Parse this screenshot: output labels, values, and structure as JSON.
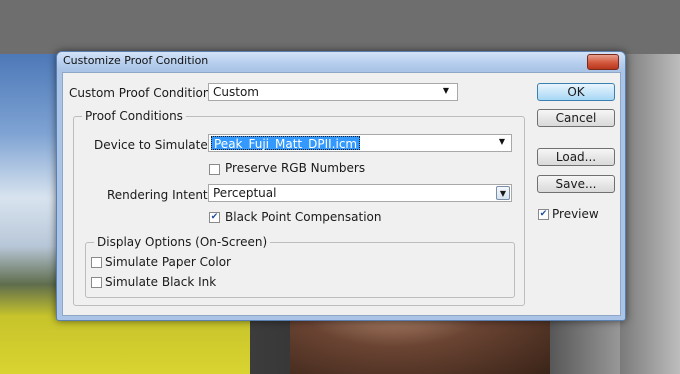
{
  "dialog": {
    "title": "Customize Proof Condition",
    "close_glyph": "✕"
  },
  "custom_condition": {
    "label": "Custom Proof Condition:",
    "value": "Custom"
  },
  "proof_conditions": {
    "group_title": "Proof Conditions",
    "device_label": "Device to Simulate:",
    "device_value": "Peak_Fuji_Matt_DPII.icm",
    "preserve_rgb_label": "Preserve RGB Numbers",
    "preserve_rgb_checked": false,
    "rendering_label": "Rendering Intent:",
    "rendering_value": "Perceptual",
    "black_point_label": "Black Point Compensation",
    "black_point_checked": true
  },
  "display_options": {
    "group_title": "Display Options (On-Screen)",
    "paper_color_label": "Simulate Paper Color",
    "paper_color_checked": false,
    "black_ink_label": "Simulate Black Ink",
    "black_ink_checked": false
  },
  "buttons": {
    "ok": "OK",
    "cancel": "Cancel",
    "load": "Load...",
    "save": "Save..."
  },
  "preview": {
    "label": "Preview",
    "checked": true
  },
  "icons": {
    "dropdown_arrow": "▼",
    "check_mark": "✔"
  },
  "colors": {
    "selection": "#3399ff",
    "title_bar": "#a9c4e6",
    "close_button": "#d2573b"
  }
}
